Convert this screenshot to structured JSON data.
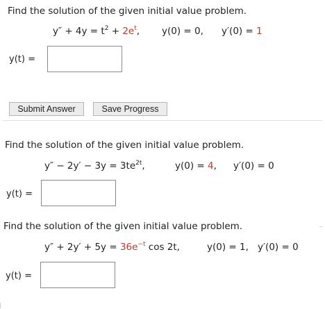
{
  "problem1": {
    "prompt": "Find the solution of the given initial value problem.",
    "equation_lhs": "y″ + 4y = t",
    "exp1": "2",
    "plus": " + ",
    "red_term": "2e",
    "red_exp": "t",
    "comma": ",",
    "ic1": "y(0) = 0,",
    "ic2_prefix": "y′(0) = ",
    "ic2_value": "1",
    "answer_label": "y(t) =",
    "answer_value": ""
  },
  "buttons": {
    "submit_label": "Submit Answer",
    "save_label": "Save Progress"
  },
  "problem2": {
    "prompt": "Find the solution of the given initial value problem.",
    "equation_lhs": "y″ − 2y′ − 3y = 3te",
    "exp": "2t",
    "comma": ",",
    "ic1_prefix": "y(0) = ",
    "ic1_value": "4",
    "ic1_suffix": ",",
    "ic2": "y′(0) = 0",
    "answer_label": "y(t) =",
    "answer_value": ""
  },
  "problem3": {
    "prompt": "Find the solution of the given initial value problem.",
    "equation_lhs": "y″ + 2y′ + 5y = ",
    "red_term": "36e",
    "red_exp": "−t",
    "trailing": " cos 2t,",
    "ic1": "y(0) = 1,",
    "ic2": "y′(0) = 0",
    "answer_label": "y(t) =",
    "answer_value": ""
  },
  "colors": {
    "accent_red": "#c0392b",
    "text": "#222222"
  }
}
